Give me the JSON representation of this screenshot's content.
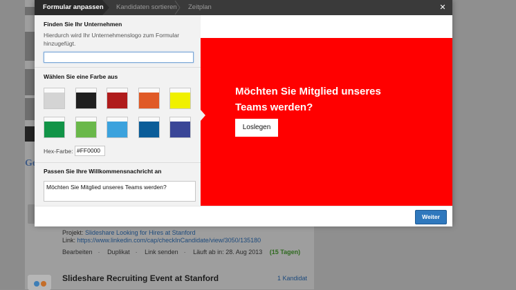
{
  "wizard": {
    "steps": [
      {
        "label": "Formular anpassen"
      },
      {
        "label": "Kandidaten sortieren"
      },
      {
        "label": "Zeitplan"
      }
    ],
    "close_icon": "close-icon"
  },
  "company": {
    "title": "Finden Sie Ihr Unternehmen",
    "description": "Hierdurch wird Ihr Unternehmenslogo zum Formular hinzugefügt.",
    "input_value": ""
  },
  "color": {
    "title": "Wählen Sie eine Farbe aus",
    "swatches": [
      "#d4d4d4",
      "#1f1f1f",
      "#b01c1c",
      "#e05a26",
      "#f0f000",
      "#119447",
      "#6ab84a",
      "#3ba2dd",
      "#0b5d99",
      "#3a4697"
    ],
    "hex_label": "Hex-Farbe:",
    "hex_value": "#FF0000"
  },
  "welcome": {
    "title": "Passen Sie Ihre Willkommensnachricht an",
    "message": "Möchten Sie Mitglied unseres Teams werden?"
  },
  "preview": {
    "headline": "Möchten Sie Mitglied unseres Teams werden?",
    "button": "Loslegen",
    "background": "#FF0000"
  },
  "footer": {
    "next_button": "Weiter"
  },
  "background_page": {
    "google_fragment": "Go",
    "project_label": "Projekt:",
    "project_link": "Slideshare Looking for Hires at Stanford",
    "link_label": "Link:",
    "link_url": "https://www.linkedin.com/cap/checkInCandidate/view/3050/135180",
    "actions": [
      "Bearbeiten",
      "Duplikat",
      "Link senden"
    ],
    "expires_label": "Läuft ab in: 28. Aug 2013",
    "expires_days": "(15 Tagen)",
    "event_title": "Slideshare Recruiting Event at Stanford",
    "event_count": "1 Kandidat"
  }
}
